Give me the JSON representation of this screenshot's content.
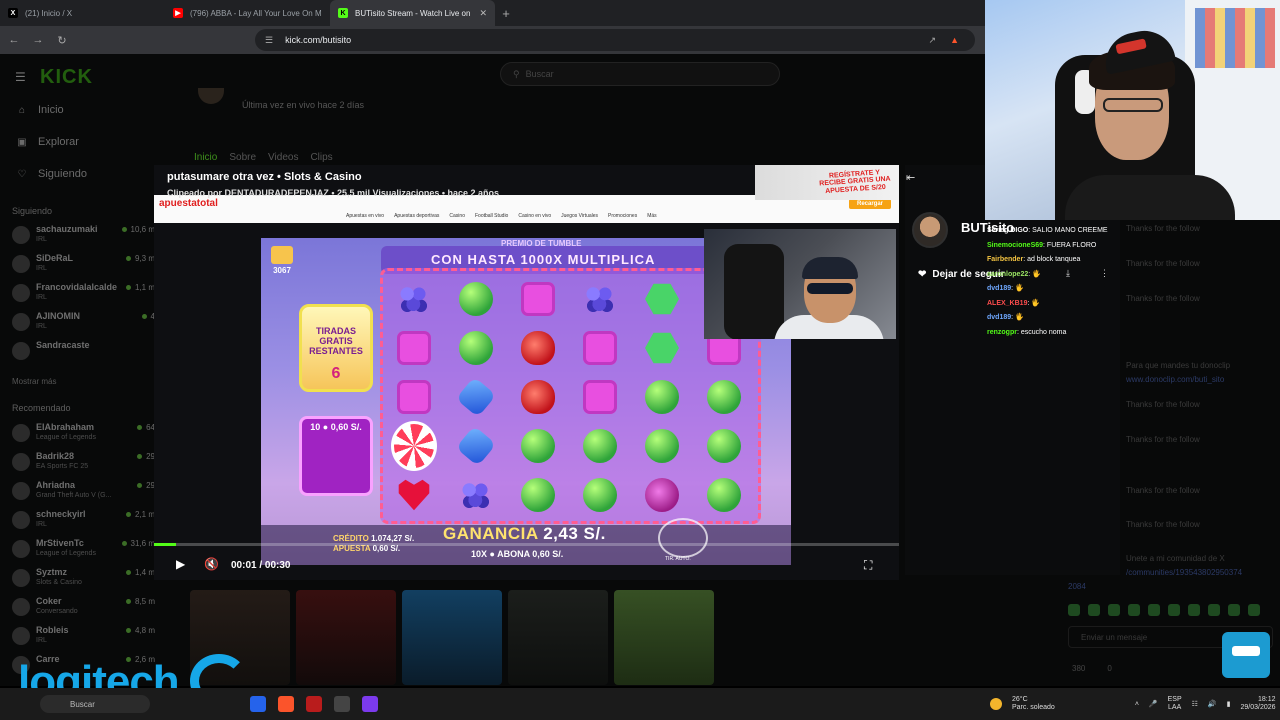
{
  "browser": {
    "tabs": [
      {
        "title": "(21) Inicio / X",
        "favicon": "x-icon",
        "active": false
      },
      {
        "title": "(796) ABBA - Lay All Your Love On M",
        "favicon": "youtube-icon",
        "active": false
      },
      {
        "title": "BUTisito Stream - Watch Live on",
        "favicon": "kick-icon",
        "active": true
      }
    ],
    "url": "kick.com/butisito"
  },
  "site": {
    "logo": "KICK",
    "search_placeholder": "Buscar",
    "nav": [
      {
        "label": "Inicio",
        "icon": "home-icon"
      },
      {
        "label": "Explorar",
        "icon": "compass-icon"
      },
      {
        "label": "Siguiendo",
        "icon": "heart-icon"
      }
    ],
    "following_label": "Siguiendo",
    "following": [
      {
        "name": "sachauzumaki",
        "sub": "IRL",
        "viewers": "10,6 m"
      },
      {
        "name": "SiDeRaL",
        "sub": "IRL",
        "viewers": "9,3 m"
      },
      {
        "name": "Francovidalalcalde",
        "sub": "IRL",
        "viewers": "1,1 m"
      },
      {
        "name": "AJINOMIN",
        "sub": "IRL",
        "viewers": "4"
      },
      {
        "name": "Sandracaste",
        "sub": "",
        "viewers": ""
      }
    ],
    "show_more": "Mostrar más",
    "recommended_label": "Recomendado",
    "recommended": [
      {
        "name": "ElAbrahaham",
        "sub": "League of Legends",
        "viewers": "64"
      },
      {
        "name": "Badrik28",
        "sub": "EA Sports FC 25",
        "viewers": "29"
      },
      {
        "name": "Ahriadna",
        "sub": "Grand Theft Auto V (G...",
        "viewers": "29"
      },
      {
        "name": "schneckyirl",
        "sub": "IRL",
        "viewers": "2,1 m"
      },
      {
        "name": "MrStivenTc",
        "sub": "League of Legends",
        "viewers": "31,6 m"
      },
      {
        "name": "Syztmz",
        "sub": "Slots & Casino",
        "viewers": "1,4 m"
      },
      {
        "name": "Coker",
        "sub": "Conversando",
        "viewers": "8,5 m"
      },
      {
        "name": "Robleis",
        "sub": "IRL",
        "viewers": "4,8 m"
      },
      {
        "name": "Carre",
        "sub": "",
        "viewers": "2,6 m"
      }
    ]
  },
  "profile": {
    "last_live": "Última vez en vivo hace 2 días",
    "tabs": [
      "Inicio",
      "Sobre",
      "Videos",
      "Clips"
    ]
  },
  "video": {
    "title": "putasumare otra vez • Slots & Casino",
    "subtitle": "Clipeado por DENTADURADEPENJAZ • 25,5 mil Visualizaciones • hace 2 años",
    "time": "00:01 / 00:30",
    "progress": 0.03
  },
  "casino_site": {
    "logo": "apuestatotal",
    "menu": [
      "Apuestas en vivo",
      "Apuestas deportivas",
      "Casino",
      "Football Studio",
      "Casino en vivo",
      "Juegos Virtuales",
      "Promociones",
      "Más"
    ],
    "recharge": "Recargar",
    "promo": "REGÍSTRATE Y RECIBE GRATIS UNA APUESTA DE S/20"
  },
  "game": {
    "tumble_label": "PREMIO DE TUMBLE",
    "multiplier_banner": "CON HASTA 1000X MULTIPLICA",
    "free_spins_label": "TIRADAS GRATIS RESTANTES",
    "free_spins_count": "6",
    "gift_count": "3067",
    "bet_box_value": "10 ● 0,60 S/.",
    "credit_label": "CRÉDITO",
    "credit_value": "1.074,27 S/.",
    "bet_label": "APUESTA",
    "bet_value": "0,60 S/.",
    "win_label": "GANANCIA",
    "win_value": "2,43 S/.",
    "pay_line": "10X ● ABONA 0,60 S/.",
    "auto_label": "TIR. AUTO.",
    "grid": [
      [
        "grape",
        "green",
        "square",
        "grape",
        "hex",
        "square"
      ],
      [
        "square",
        "green",
        "apple",
        "square",
        "hex",
        "square"
      ],
      [
        "square",
        "blue",
        "apple",
        "square",
        "green",
        "green"
      ],
      [
        "lolli",
        "blue",
        "green",
        "green",
        "green",
        "green"
      ],
      [
        "heart",
        "grape",
        "green",
        "green",
        "plum",
        "green"
      ]
    ]
  },
  "chat": {
    "streamer": "BUTisito",
    "follow_button": "Dejar de seguir",
    "messages": [
      {
        "user": "Serieg DIGO",
        "text": "SALIO MANO CREEME",
        "color": "#ffffff"
      },
      {
        "user": "SinemocioneS69",
        "text": "FUERA FLORO",
        "color": "#53fc18"
      },
      {
        "user": "Fairbender",
        "text": "ad block tanquea",
        "color": "#f5c542"
      },
      {
        "user": "aaronlope22",
        "text": "",
        "color": "#9be564"
      },
      {
        "user": "dvd189",
        "text": "",
        "color": "#6fa8ff"
      },
      {
        "user": "ALEX_KB19",
        "text": "",
        "color": "#ff4d4d"
      },
      {
        "user": "dvd189",
        "text": "",
        "color": "#6fa8ff"
      },
      {
        "user": "renzogpr",
        "text": "escucho noma",
        "color": "#53fc18"
      }
    ]
  },
  "side_panel": {
    "follow_thanks": "Thanks for the follow",
    "donoclip_text": "Para que mandes tu donoclip",
    "donoclip_link": "www.donoclip.com/buti_sito",
    "community_text": "Unete a mi comunidad de X",
    "community_link": "/communities/193543802950374",
    "community_num": "2084",
    "input_placeholder": "Enviar un mensaje",
    "stats": [
      "380",
      "0"
    ]
  },
  "watermark": "logitech",
  "taskbar": {
    "search": "Buscar",
    "weather_temp": "26°C",
    "weather_desc": "Parc. soleado",
    "lang_top": "ESP",
    "lang_bottom": "LAA",
    "time": "18:12",
    "date": "29/03/2026"
  }
}
